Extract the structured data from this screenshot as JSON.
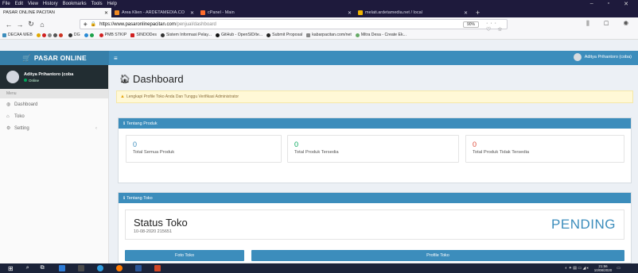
{
  "menubar": [
    "File",
    "Edit",
    "View",
    "History",
    "Bookmarks",
    "Tools",
    "Help"
  ],
  "tabs": [
    {
      "label": "PASAR ONLINE PACITAN",
      "active": true,
      "color": "#ffffff"
    },
    {
      "label": "Area Klien - ARDETAMEDIA.CO",
      "active": false,
      "color": "#f08a24"
    },
    {
      "label": "cPanel - Main",
      "active": false,
      "color": "#ff6c2c"
    },
    {
      "label": "melati.ardetamedia.net / local",
      "active": false,
      "color": "#f0b400"
    }
  ],
  "url": {
    "host": "https://www.pasaronlinepacitan.com",
    "path": "/penjual/dashboard",
    "zoom": "90%"
  },
  "bookmarks": [
    "DECAA WEB",
    "DG",
    "PMB STKIP",
    "SINDODes",
    "Sistem Informasi Pelay...",
    "GitHub - OpenSID/te...",
    "Submit Proposal",
    "kabarpacitan.com/net",
    "Mitra Desa - Create Ek..."
  ],
  "app": {
    "logo": "PASAR ONLINE",
    "top_user": "Aditya Prihantoro (coba)",
    "sidebar_user": "Aditya Prihantoro (coba",
    "sidebar_status": "Online",
    "menu_header": "Menu",
    "menu": [
      {
        "label": "Dashboard",
        "icon": "dashboard-icon"
      },
      {
        "label": "Toko",
        "icon": "home-icon"
      },
      {
        "label": "Setting",
        "icon": "gear-icon"
      }
    ]
  },
  "page": {
    "title": "Dashboard",
    "alert": "Lengkapi Profile Toko Anda Dan Tunggu Verifikasi Administrator",
    "produk_header": "Tentang Produk",
    "stats": [
      {
        "num": "0",
        "label": "Total Semua Produk",
        "color": "#3c8dbc"
      },
      {
        "num": "0",
        "label": "Total Produk Tersedia",
        "color": "#00a65a"
      },
      {
        "num": "0",
        "label": "Total Produk Tidak Tersedia",
        "color": "#dd4b39"
      }
    ],
    "toko_header": "Tentang Toko",
    "status_title": "Status Toko",
    "status_date": "10-08-2020 215651",
    "status_value": "PENDING",
    "btn_foto": "Foto Toko",
    "btn_profile": "Profile Toko"
  },
  "taskbar": {
    "time": "21:56",
    "date": "10/08/2020"
  }
}
